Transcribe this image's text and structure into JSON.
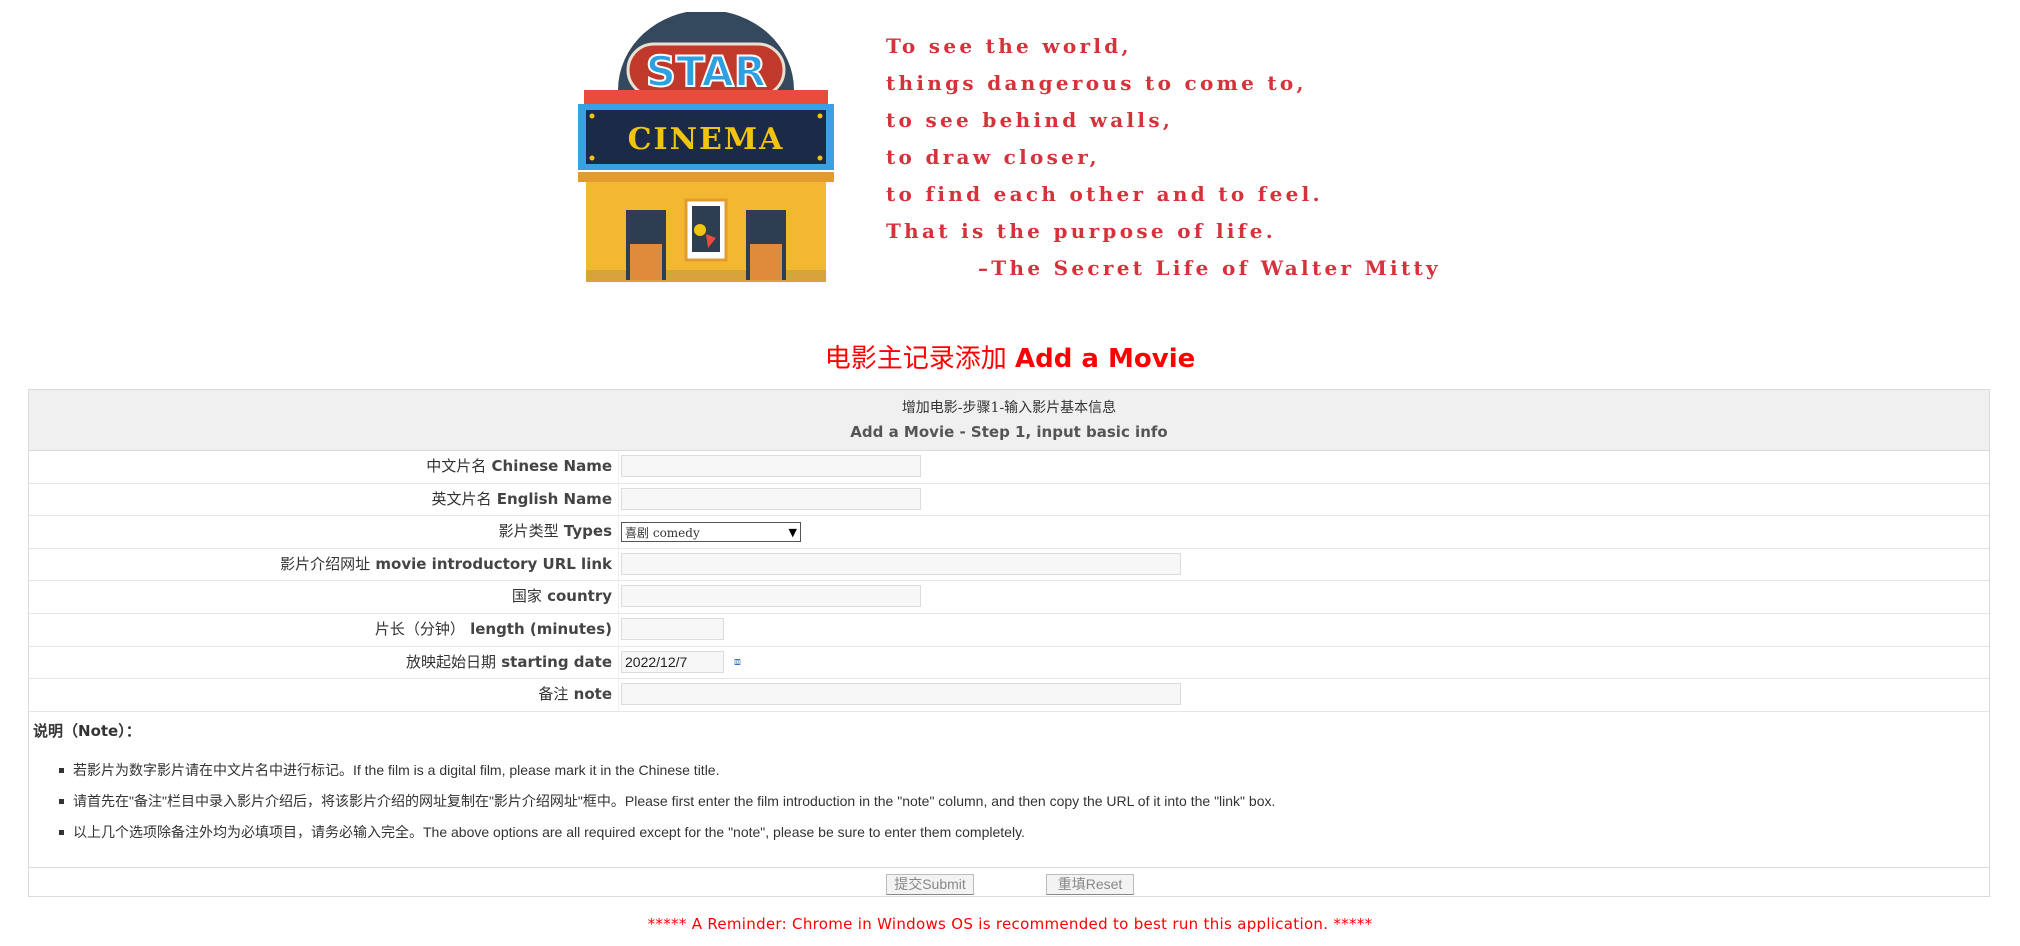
{
  "logo": {
    "sign_text": "STAR",
    "marquee_text": "CINEMA"
  },
  "quote": {
    "lines": [
      "To see the world,",
      "things dangerous to come to,",
      "to see behind walls,",
      "to draw closer,",
      "to find each other and to feel.",
      "That is the purpose of life."
    ],
    "attribution": "–The Secret Life of Walter Mitty"
  },
  "page_title": {
    "cn": "电影主记录添加",
    "en": "Add a Movie"
  },
  "form": {
    "header_cn": "增加电影-步骤1-输入影片基本信息",
    "header_en": "Add a Movie - Step 1, input basic info",
    "fields": {
      "chinese_name": {
        "label_cn": "中文片名",
        "label_en": "Chinese Name",
        "value": ""
      },
      "english_name": {
        "label_cn": "英文片名",
        "label_en": "English Name",
        "value": ""
      },
      "types": {
        "label_cn": "影片类型",
        "label_en": "Types",
        "selected_cn": "喜剧",
        "selected_en": "comedy"
      },
      "url_link": {
        "label_cn": "影片介绍网址",
        "label_en": "movie introductory URL link",
        "value": ""
      },
      "country": {
        "label_cn": "国家",
        "label_en": "country",
        "value": ""
      },
      "length": {
        "label_cn": "片长（分钟）",
        "label_en": "length (minutes)",
        "value": ""
      },
      "starting_date": {
        "label_cn": "放映起始日期",
        "label_en": "starting date",
        "value": "2022/12/7"
      },
      "note": {
        "label_cn": "备注",
        "label_en": "note",
        "value": ""
      }
    },
    "note_section": {
      "title_cn": "说明（",
      "title_en": "Note",
      "title_end": "）：",
      "items": [
        "若影片为数字影片请在中文片名中进行标记。If the film is a digital film, please mark it in the Chinese title.",
        "请首先在\"备注\"栏目中录入影片介绍后，将该影片介绍的网址复制在\"影片介绍网址\"框中。Please first enter the film introduction in the \"note\" column, and then copy the URL of it into the \"link\" box.",
        "以上几个选项除备注外均为必填项目，请务必输入完全。The above options are all required except for the \"note\", please be sure to enter them completely."
      ]
    },
    "buttons": {
      "submit": "提交Submit",
      "reset": "重填Reset"
    }
  },
  "reminder": "***** A Reminder: Chrome in Windows OS is recommended to best run this application. *****",
  "colors": {
    "accent_red": "#ff0000",
    "quote_red": "#d6323c",
    "header_bg": "#f0f0f0"
  }
}
